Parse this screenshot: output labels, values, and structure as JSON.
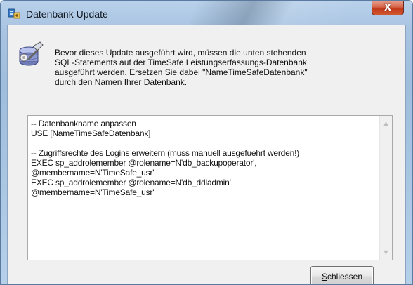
{
  "window": {
    "title": "Datenbank Update",
    "close_glyph": "X"
  },
  "info": {
    "icon": "database-wrench-icon",
    "lines": [
      "Bevor dieses Update ausgeführt wird, müssen die unten stehenden",
      "SQL-Statements auf der TimeSafe Leistungserfassungs-Datenbank",
      "ausgeführt werden. Ersetzen Sie dabei \"NameTimeSafeDatenbank\"",
      "durch den Namen Ihrer Datenbank."
    ]
  },
  "sql": {
    "lines": [
      "-- Datenbankname anpassen",
      "USE [NameTimeSafeDatenbank]",
      "",
      "-- Zugriffsrechte des Logins erweitern (muss manuell ausgefuehrt werden!)",
      "EXEC sp_addrolemember @rolename=N'db_backupoperator',",
      "@membername=N'TimeSafe_usr'",
      "EXEC sp_addrolemember @rolename=N'db_ddladmin',",
      "@membername=N'TimeSafe_usr'"
    ]
  },
  "buttons": {
    "close_accel": "S",
    "close_rest": "chliessen"
  }
}
